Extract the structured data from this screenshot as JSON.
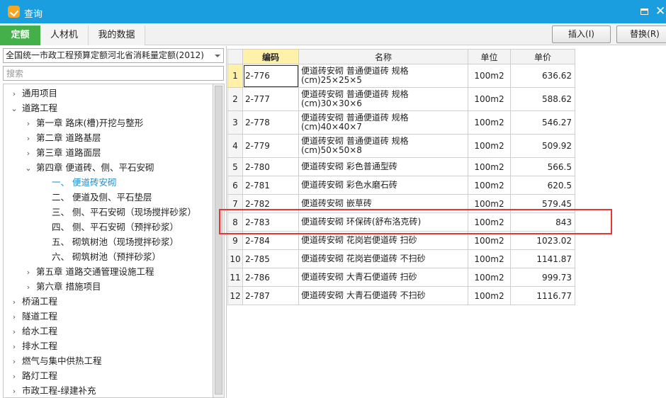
{
  "window": {
    "title": "查询",
    "accent": "#1a9ee0"
  },
  "tabs": [
    {
      "label": "定额",
      "active": true
    },
    {
      "label": "人材机",
      "active": false
    },
    {
      "label": "我的数据",
      "active": false
    }
  ],
  "toolbar": {
    "insert_label": "插入(I)",
    "replace_label": "替换(R)"
  },
  "quota_select": {
    "value": "全国统一市政工程预算定额河北省消耗量定额(2012)"
  },
  "search": {
    "placeholder": "搜索"
  },
  "tree": [
    {
      "label": "通用项目",
      "level": 0,
      "expanded": false
    },
    {
      "label": "道路工程",
      "level": 0,
      "expanded": true
    },
    {
      "label": "第一章 路床(槽)开挖与整形",
      "level": 1,
      "expanded": false
    },
    {
      "label": "第二章 道路基层",
      "level": 1,
      "expanded": false
    },
    {
      "label": "第三章 道路面层",
      "level": 1,
      "expanded": false
    },
    {
      "label": "第四章 便道砖、侧、平石安砌",
      "level": 1,
      "expanded": true
    },
    {
      "label": "一、 便道砖安砌",
      "level": 2,
      "selected": true
    },
    {
      "label": "二、 便道及侧、平石垫层",
      "level": 2
    },
    {
      "label": "三、 侧、平石安砌（现场搅拌砂浆）",
      "level": 2
    },
    {
      "label": "四、 侧、平石安砌（预拌砂浆）",
      "level": 2
    },
    {
      "label": "五、 砌筑树池（现场搅拌砂浆）",
      "level": 2
    },
    {
      "label": "六、 砌筑树池（预拌砂浆）",
      "level": 2
    },
    {
      "label": "第五章 道路交通管理设施工程",
      "level": 1,
      "expanded": false
    },
    {
      "label": "第六章 措施项目",
      "level": 1,
      "expanded": false
    },
    {
      "label": "桥涵工程",
      "level": 0,
      "expanded": false
    },
    {
      "label": "隧道工程",
      "level": 0,
      "expanded": false
    },
    {
      "label": "给水工程",
      "level": 0,
      "expanded": false
    },
    {
      "label": "排水工程",
      "level": 0,
      "expanded": false
    },
    {
      "label": "燃气与集中供热工程",
      "level": 0,
      "expanded": false
    },
    {
      "label": "路灯工程",
      "level": 0,
      "expanded": false
    },
    {
      "label": "市政工程-绿建补充",
      "level": 0,
      "expanded": false
    }
  ],
  "grid": {
    "columns": {
      "code": "编码",
      "name": "名称",
      "unit": "单位",
      "price": "单价"
    },
    "rows": [
      {
        "n": "1",
        "code": "2-776",
        "name": "便道砖安砌 普通便道砖 规格(cm)25×25×5",
        "unit": "100m2",
        "price": "636.62"
      },
      {
        "n": "2",
        "code": "2-777",
        "name": "便道砖安砌 普通便道砖 规格(cm)30×30×6",
        "unit": "100m2",
        "price": "588.62"
      },
      {
        "n": "3",
        "code": "2-778",
        "name": "便道砖安砌 普通便道砖 规格(cm)40×40×7",
        "unit": "100m2",
        "price": "546.27"
      },
      {
        "n": "4",
        "code": "2-779",
        "name": "便道砖安砌 普通便道砖 规格(cm)50×50×8",
        "unit": "100m2",
        "price": "509.92"
      },
      {
        "n": "5",
        "code": "2-780",
        "name": "便道砖安砌 彩色普通型砖",
        "unit": "100m2",
        "price": "566.5"
      },
      {
        "n": "6",
        "code": "2-781",
        "name": "便道砖安砌 彩色水磨石砖",
        "unit": "100m2",
        "price": "620.5"
      },
      {
        "n": "7",
        "code": "2-782",
        "name": "便道砖安砌 嵌草砖",
        "unit": "100m2",
        "price": "579.45"
      },
      {
        "n": "8",
        "code": "2-783",
        "name": "便道砖安砌 环保砖(舒布洛克砖)",
        "unit": "100m2",
        "price": "843"
      },
      {
        "n": "9",
        "code": "2-784",
        "name": "便道砖安砌 花岗岩便道砖 扫砂",
        "unit": "100m2",
        "price": "1023.02"
      },
      {
        "n": "10",
        "code": "2-785",
        "name": "便道砖安砌 花岗岩便道砖 不扫砂",
        "unit": "100m2",
        "price": "1141.87"
      },
      {
        "n": "11",
        "code": "2-786",
        "name": "便道砖安砌 大青石便道砖 扫砂",
        "unit": "100m2",
        "price": "999.73"
      },
      {
        "n": "12",
        "code": "2-787",
        "name": "便道砖安砌 大青石便道砖 不扫砂",
        "unit": "100m2",
        "price": "1116.77"
      }
    ]
  },
  "colors": {
    "active_tab": "#43b049",
    "highlight": "#e83535",
    "selected_tree": "#1b8fd0"
  }
}
